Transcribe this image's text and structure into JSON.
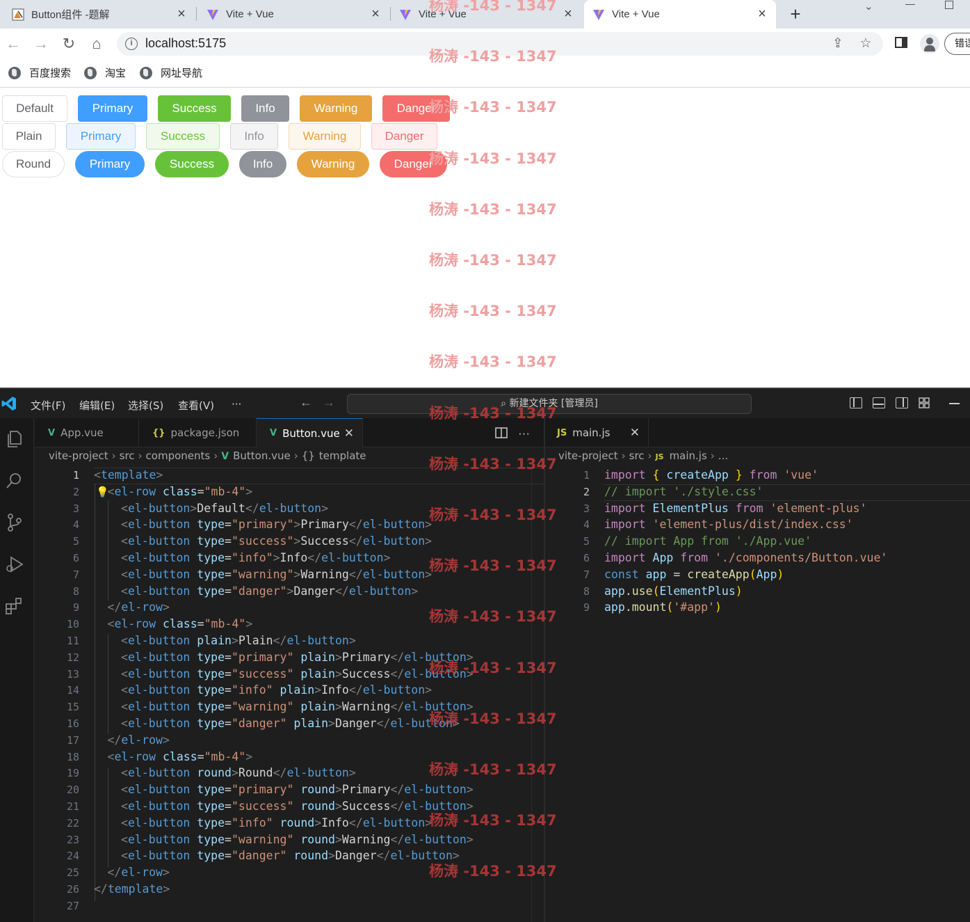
{
  "browser": {
    "tabs": [
      {
        "title": "Button组件 -题解",
        "active": false
      },
      {
        "title": "Vite + Vue",
        "active": false
      },
      {
        "title": "Vite + Vue",
        "active": false
      },
      {
        "title": "Vite + Vue",
        "active": true
      }
    ],
    "url": "localhost:5175",
    "error_button": "错误",
    "bookmarks": [
      "百度搜索",
      "淘宝",
      "网址导航"
    ]
  },
  "page": {
    "rows": [
      {
        "style": "default",
        "buttons": [
          {
            "type": "default",
            "label": "Default"
          },
          {
            "type": "primary",
            "label": "Primary"
          },
          {
            "type": "success",
            "label": "Success"
          },
          {
            "type": "info",
            "label": "Info"
          },
          {
            "type": "warning",
            "label": "Warning"
          },
          {
            "type": "danger",
            "label": "Danger"
          }
        ]
      },
      {
        "style": "plain",
        "buttons": [
          {
            "type": "default",
            "label": "Plain"
          },
          {
            "type": "primary",
            "label": "Primary"
          },
          {
            "type": "success",
            "label": "Success"
          },
          {
            "type": "info",
            "label": "Info"
          },
          {
            "type": "warning",
            "label": "Warning"
          },
          {
            "type": "danger",
            "label": "Danger"
          }
        ]
      },
      {
        "style": "round",
        "buttons": [
          {
            "type": "default",
            "label": "Round"
          },
          {
            "type": "primary",
            "label": "Primary"
          },
          {
            "type": "success",
            "label": "Success"
          },
          {
            "type": "info",
            "label": "Info"
          },
          {
            "type": "warning",
            "label": "Warning"
          },
          {
            "type": "danger",
            "label": "Danger"
          }
        ]
      }
    ]
  },
  "watermark": "杨涛 -143 - 1347",
  "vscode": {
    "menu": [
      "文件(F)",
      "编辑(E)",
      "选择(S)",
      "查看(V)",
      "···"
    ],
    "command_center": "新建文件夹 [管理员]",
    "left_tabs": [
      {
        "name": "App.vue",
        "icon": "vue-icon",
        "active": false
      },
      {
        "name": "package.json",
        "icon": "json-icon",
        "active": false
      },
      {
        "name": "Button.vue",
        "icon": "vue-icon",
        "active": true
      }
    ],
    "right_tabs": [
      {
        "name": "main.js",
        "icon": "js-icon",
        "active": true
      }
    ],
    "left_breadcrumb": [
      "vite-project",
      "src",
      "components",
      "Button.vue",
      "template"
    ],
    "right_breadcrumb": [
      "vite-project",
      "src",
      "main.js",
      "..."
    ],
    "left_current_line": 1,
    "right_current_line": 2,
    "left_code": [
      [
        [
          "t-br",
          "<"
        ],
        [
          "t-tag",
          "template"
        ],
        [
          "t-br",
          ">"
        ]
      ],
      [
        [
          "t-br",
          "<"
        ],
        [
          "t-tag",
          "el-row "
        ],
        [
          "t-attr",
          "class"
        ],
        [
          "t-txt",
          "="
        ],
        [
          "t-str",
          "\"mb-4\""
        ],
        [
          "t-br",
          ">"
        ]
      ],
      [
        [
          "t-br",
          "<"
        ],
        [
          "t-tag",
          "el-button"
        ],
        [
          "t-br",
          ">"
        ],
        [
          "t-txt",
          "Default"
        ],
        [
          "t-br",
          "</"
        ],
        [
          "t-tag",
          "el-button"
        ],
        [
          "t-br",
          ">"
        ]
      ],
      [
        [
          "t-br",
          "<"
        ],
        [
          "t-tag",
          "el-button "
        ],
        [
          "t-attr",
          "type"
        ],
        [
          "t-txt",
          "="
        ],
        [
          "t-str",
          "\"primary\""
        ],
        [
          "t-br",
          ">"
        ],
        [
          "t-txt",
          "Primary"
        ],
        [
          "t-br",
          "</"
        ],
        [
          "t-tag",
          "el-button"
        ],
        [
          "t-br",
          ">"
        ]
      ],
      [
        [
          "t-br",
          "<"
        ],
        [
          "t-tag",
          "el-button "
        ],
        [
          "t-attr",
          "type"
        ],
        [
          "t-txt",
          "="
        ],
        [
          "t-str",
          "\"success\""
        ],
        [
          "t-br",
          ">"
        ],
        [
          "t-txt",
          "Success"
        ],
        [
          "t-br",
          "</"
        ],
        [
          "t-tag",
          "el-button"
        ],
        [
          "t-br",
          ">"
        ]
      ],
      [
        [
          "t-br",
          "<"
        ],
        [
          "t-tag",
          "el-button "
        ],
        [
          "t-attr",
          "type"
        ],
        [
          "t-txt",
          "="
        ],
        [
          "t-str",
          "\"info\""
        ],
        [
          "t-br",
          ">"
        ],
        [
          "t-txt",
          "Info"
        ],
        [
          "t-br",
          "</"
        ],
        [
          "t-tag",
          "el-button"
        ],
        [
          "t-br",
          ">"
        ]
      ],
      [
        [
          "t-br",
          "<"
        ],
        [
          "t-tag",
          "el-button "
        ],
        [
          "t-attr",
          "type"
        ],
        [
          "t-txt",
          "="
        ],
        [
          "t-str",
          "\"warning\""
        ],
        [
          "t-br",
          ">"
        ],
        [
          "t-txt",
          "Warning"
        ],
        [
          "t-br",
          "</"
        ],
        [
          "t-tag",
          "el-button"
        ],
        [
          "t-br",
          ">"
        ]
      ],
      [
        [
          "t-br",
          "<"
        ],
        [
          "t-tag",
          "el-button "
        ],
        [
          "t-attr",
          "type"
        ],
        [
          "t-txt",
          "="
        ],
        [
          "t-str",
          "\"danger\""
        ],
        [
          "t-br",
          ">"
        ],
        [
          "t-txt",
          "Danger"
        ],
        [
          "t-br",
          "</"
        ],
        [
          "t-tag",
          "el-button"
        ],
        [
          "t-br",
          ">"
        ]
      ],
      [
        [
          "t-br",
          "</"
        ],
        [
          "t-tag",
          "el-row"
        ],
        [
          "t-br",
          ">"
        ]
      ],
      [
        [
          "t-br",
          "<"
        ],
        [
          "t-tag",
          "el-row "
        ],
        [
          "t-attr",
          "class"
        ],
        [
          "t-txt",
          "="
        ],
        [
          "t-str",
          "\"mb-4\""
        ],
        [
          "t-br",
          ">"
        ]
      ],
      [
        [
          "t-br",
          "<"
        ],
        [
          "t-tag",
          "el-button "
        ],
        [
          "t-attr",
          "plain"
        ],
        [
          "t-br",
          ">"
        ],
        [
          "t-txt",
          "Plain"
        ],
        [
          "t-br",
          "</"
        ],
        [
          "t-tag",
          "el-button"
        ],
        [
          "t-br",
          ">"
        ]
      ],
      [
        [
          "t-br",
          "<"
        ],
        [
          "t-tag",
          "el-button "
        ],
        [
          "t-attr",
          "type"
        ],
        [
          "t-txt",
          "="
        ],
        [
          "t-str",
          "\"primary\" "
        ],
        [
          "t-attr",
          "plain"
        ],
        [
          "t-br",
          ">"
        ],
        [
          "t-txt",
          "Primary"
        ],
        [
          "t-br",
          "</"
        ],
        [
          "t-tag",
          "el-button"
        ],
        [
          "t-br",
          ">"
        ]
      ],
      [
        [
          "t-br",
          "<"
        ],
        [
          "t-tag",
          "el-button "
        ],
        [
          "t-attr",
          "type"
        ],
        [
          "t-txt",
          "="
        ],
        [
          "t-str",
          "\"success\" "
        ],
        [
          "t-attr",
          "plain"
        ],
        [
          "t-br",
          ">"
        ],
        [
          "t-txt",
          "Success"
        ],
        [
          "t-br",
          "</"
        ],
        [
          "t-tag",
          "el-button"
        ],
        [
          "t-br",
          ">"
        ]
      ],
      [
        [
          "t-br",
          "<"
        ],
        [
          "t-tag",
          "el-button "
        ],
        [
          "t-attr",
          "type"
        ],
        [
          "t-txt",
          "="
        ],
        [
          "t-str",
          "\"info\" "
        ],
        [
          "t-attr",
          "plain"
        ],
        [
          "t-br",
          ">"
        ],
        [
          "t-txt",
          "Info"
        ],
        [
          "t-br",
          "</"
        ],
        [
          "t-tag",
          "el-button"
        ],
        [
          "t-br",
          ">"
        ]
      ],
      [
        [
          "t-br",
          "<"
        ],
        [
          "t-tag",
          "el-button "
        ],
        [
          "t-attr",
          "type"
        ],
        [
          "t-txt",
          "="
        ],
        [
          "t-str",
          "\"warning\" "
        ],
        [
          "t-attr",
          "plain"
        ],
        [
          "t-br",
          ">"
        ],
        [
          "t-txt",
          "Warning"
        ],
        [
          "t-br",
          "</"
        ],
        [
          "t-tag",
          "el-button"
        ],
        [
          "t-br",
          ">"
        ]
      ],
      [
        [
          "t-br",
          "<"
        ],
        [
          "t-tag",
          "el-button "
        ],
        [
          "t-attr",
          "type"
        ],
        [
          "t-txt",
          "="
        ],
        [
          "t-str",
          "\"danger\" "
        ],
        [
          "t-attr",
          "plain"
        ],
        [
          "t-br",
          ">"
        ],
        [
          "t-txt",
          "Danger"
        ],
        [
          "t-br",
          "</"
        ],
        [
          "t-tag",
          "el-button"
        ],
        [
          "t-br",
          ">"
        ]
      ],
      [
        [
          "t-br",
          "</"
        ],
        [
          "t-tag",
          "el-row"
        ],
        [
          "t-br",
          ">"
        ]
      ],
      [
        [
          "t-br",
          "<"
        ],
        [
          "t-tag",
          "el-row "
        ],
        [
          "t-attr",
          "class"
        ],
        [
          "t-txt",
          "="
        ],
        [
          "t-str",
          "\"mb-4\""
        ],
        [
          "t-br",
          ">"
        ]
      ],
      [
        [
          "t-br",
          "<"
        ],
        [
          "t-tag",
          "el-button "
        ],
        [
          "t-attr",
          "round"
        ],
        [
          "t-br",
          ">"
        ],
        [
          "t-txt",
          "Round"
        ],
        [
          "t-br",
          "</"
        ],
        [
          "t-tag",
          "el-button"
        ],
        [
          "t-br",
          ">"
        ]
      ],
      [
        [
          "t-br",
          "<"
        ],
        [
          "t-tag",
          "el-button "
        ],
        [
          "t-attr",
          "type"
        ],
        [
          "t-txt",
          "="
        ],
        [
          "t-str",
          "\"primary\" "
        ],
        [
          "t-attr",
          "round"
        ],
        [
          "t-br",
          ">"
        ],
        [
          "t-txt",
          "Primary"
        ],
        [
          "t-br",
          "</"
        ],
        [
          "t-tag",
          "el-button"
        ],
        [
          "t-br",
          ">"
        ]
      ],
      [
        [
          "t-br",
          "<"
        ],
        [
          "t-tag",
          "el-button "
        ],
        [
          "t-attr",
          "type"
        ],
        [
          "t-txt",
          "="
        ],
        [
          "t-str",
          "\"success\" "
        ],
        [
          "t-attr",
          "round"
        ],
        [
          "t-br",
          ">"
        ],
        [
          "t-txt",
          "Success"
        ],
        [
          "t-br",
          "</"
        ],
        [
          "t-tag",
          "el-button"
        ],
        [
          "t-br",
          ">"
        ]
      ],
      [
        [
          "t-br",
          "<"
        ],
        [
          "t-tag",
          "el-button "
        ],
        [
          "t-attr",
          "type"
        ],
        [
          "t-txt",
          "="
        ],
        [
          "t-str",
          "\"info\" "
        ],
        [
          "t-attr",
          "round"
        ],
        [
          "t-br",
          ">"
        ],
        [
          "t-txt",
          "Info"
        ],
        [
          "t-br",
          "</"
        ],
        [
          "t-tag",
          "el-button"
        ],
        [
          "t-br",
          ">"
        ]
      ],
      [
        [
          "t-br",
          "<"
        ],
        [
          "t-tag",
          "el-button "
        ],
        [
          "t-attr",
          "type"
        ],
        [
          "t-txt",
          "="
        ],
        [
          "t-str",
          "\"warning\" "
        ],
        [
          "t-attr",
          "round"
        ],
        [
          "t-br",
          ">"
        ],
        [
          "t-txt",
          "Warning"
        ],
        [
          "t-br",
          "</"
        ],
        [
          "t-tag",
          "el-button"
        ],
        [
          "t-br",
          ">"
        ]
      ],
      [
        [
          "t-br",
          "<"
        ],
        [
          "t-tag",
          "el-button "
        ],
        [
          "t-attr",
          "type"
        ],
        [
          "t-txt",
          "="
        ],
        [
          "t-str",
          "\"danger\" "
        ],
        [
          "t-attr",
          "round"
        ],
        [
          "t-br",
          ">"
        ],
        [
          "t-txt",
          "Danger"
        ],
        [
          "t-br",
          "</"
        ],
        [
          "t-tag",
          "el-button"
        ],
        [
          "t-br",
          ">"
        ]
      ],
      [
        [
          "t-br",
          "</"
        ],
        [
          "t-tag",
          "el-row"
        ],
        [
          "t-br",
          ">"
        ]
      ],
      [
        [
          "t-br",
          "</"
        ],
        [
          "t-tag",
          "template"
        ],
        [
          "t-br",
          ">"
        ]
      ],
      []
    ],
    "left_indent": [
      0,
      1,
      2,
      2,
      2,
      2,
      2,
      2,
      1,
      1,
      2,
      2,
      2,
      2,
      2,
      2,
      1,
      1,
      2,
      2,
      2,
      2,
      2,
      2,
      1,
      0,
      0
    ],
    "right_code": [
      [
        [
          "t-kw",
          "import "
        ],
        [
          "t-brace",
          "{ "
        ],
        [
          "t-var",
          "createApp"
        ],
        [
          "t-brace",
          " }"
        ],
        [
          "t-kw",
          " from "
        ],
        [
          "t-str",
          "'vue'"
        ]
      ],
      [
        [
          "t-cm",
          "// import './style.css'"
        ]
      ],
      [
        [
          "t-kw",
          "import "
        ],
        [
          "t-var",
          "ElementPlus"
        ],
        [
          "t-kw",
          " from "
        ],
        [
          "t-str",
          "'element-plus'"
        ]
      ],
      [
        [
          "t-kw",
          "import "
        ],
        [
          "t-str",
          "'element-plus/dist/index.css'"
        ]
      ],
      [
        [
          "t-cm",
          "// import App from './App.vue'"
        ]
      ],
      [
        [
          "t-kw",
          "import "
        ],
        [
          "t-var",
          "App"
        ],
        [
          "t-kw",
          " from "
        ],
        [
          "t-str",
          "'./components/Button.vue'"
        ]
      ],
      [
        [
          "t-kw2",
          "const "
        ],
        [
          "t-var",
          "app"
        ],
        [
          "t-pn",
          " = "
        ],
        [
          "t-fn",
          "createApp"
        ],
        [
          "t-brace",
          "("
        ],
        [
          "t-var",
          "App"
        ],
        [
          "t-brace",
          ")"
        ]
      ],
      [
        [
          "t-var",
          "app"
        ],
        [
          "t-pn",
          "."
        ],
        [
          "t-fn",
          "use"
        ],
        [
          "t-brace",
          "("
        ],
        [
          "t-var",
          "ElementPlus"
        ],
        [
          "t-brace",
          ")"
        ]
      ],
      [
        [
          "t-var",
          "app"
        ],
        [
          "t-pn",
          "."
        ],
        [
          "t-fn",
          "mount"
        ],
        [
          "t-brace",
          "("
        ],
        [
          "t-str",
          "'#app'"
        ],
        [
          "t-brace",
          ")"
        ]
      ]
    ]
  }
}
